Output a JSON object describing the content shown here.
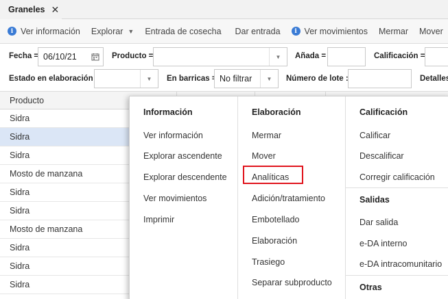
{
  "tab": {
    "label": "Graneles",
    "close_icon": "close-icon"
  },
  "toolbar": {
    "ver_informacion": "Ver información",
    "explorar": "Explorar",
    "entrada_cosecha": "Entrada de cosecha",
    "dar_entrada": "Dar entrada",
    "ver_movimientos": "Ver movimientos",
    "mermar": "Mermar",
    "mover": "Mover"
  },
  "filters": {
    "fecha_label": "Fecha =",
    "fecha_value": "06/10/21",
    "producto_label": "Producto =",
    "producto_value": "",
    "anada_label": "Añada =",
    "anada_value": "",
    "calificacion_label": "Calificación =",
    "calificacion_value": "",
    "estado_label": "Estado en elaboración =",
    "estado_value": "",
    "barricas_label": "En barricas =",
    "barricas_value": "No filtrar",
    "lote_label": "Número de lote ::",
    "lote_value": "",
    "detalles_label": "Detalles"
  },
  "grid": {
    "header": "Producto",
    "rows": [
      "Sidra",
      "Sidra",
      "Sidra",
      "Mosto de manzana",
      "Sidra",
      "Sidra",
      "Mosto de manzana",
      "Sidra",
      "Sidra",
      "Sidra"
    ],
    "selected_index": 1
  },
  "menu": {
    "informacion": {
      "title": "Información",
      "items": [
        "Ver información",
        "Explorar ascendente",
        "Explorar descendente",
        "Ver movimientos",
        "Imprimir"
      ]
    },
    "elaboracion": {
      "title": "Elaboración",
      "items": [
        "Mermar",
        "Mover",
        "Analíticas",
        "Adición/tratamiento",
        "Embotellado",
        "Elaboración",
        "Trasiego",
        "Separar subproducto"
      ],
      "highlighted": "Analíticas"
    },
    "calificacion": {
      "title": "Calificación",
      "items": [
        "Calificar",
        "Descalificar",
        "Corregir calificación"
      ]
    },
    "salidas": {
      "title": "Salidas",
      "items": [
        "Dar salida",
        "e-DA interno",
        "e-DA intracomunitario"
      ]
    },
    "otras": {
      "title": "Otras"
    }
  },
  "colors": {
    "accent": "#3a7bd5",
    "highlight": "#e0121b",
    "selected_row": "#dbe6f6"
  }
}
